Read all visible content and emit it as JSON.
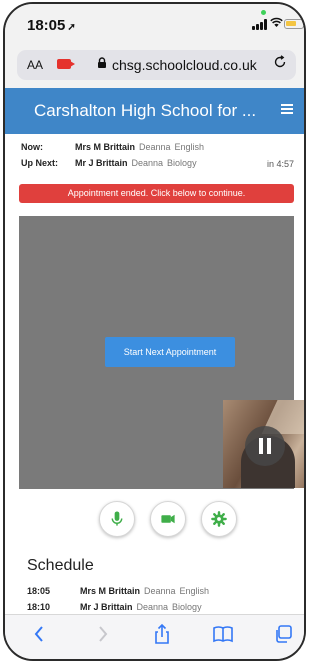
{
  "status": {
    "time": "18:05",
    "location_arrow": "➚"
  },
  "browser": {
    "text_size_label": "AA",
    "url": "chsg.schoolcloud.co.uk"
  },
  "header": {
    "title": "Carshalton High School for ..."
  },
  "appointment": {
    "now_label": "Now:",
    "now_teacher": "Mrs M Brittain",
    "now_student": "Deanna",
    "now_subject": "English",
    "next_label": "Up Next:",
    "next_teacher": "Mr J Brittain",
    "next_student": "Deanna",
    "next_subject": "Biology",
    "next_in": "in 4:57"
  },
  "alert": {
    "text": "Appointment ended. Click below to continue."
  },
  "video": {
    "start_button_label": "Start Next Appointment"
  },
  "controls": {
    "accent": "#3fae49"
  },
  "schedule": {
    "title": "Schedule",
    "rows": [
      {
        "time": "18:05",
        "teacher": "Mrs M Brittain",
        "student": "Deanna",
        "subject": "English"
      },
      {
        "time": "18:10",
        "teacher": "Mr J Brittain",
        "student": "Deanna",
        "subject": "Biology"
      }
    ]
  },
  "colors": {
    "header": "#3f86c8",
    "alert": "#e0403d",
    "button": "#3c8fe0"
  }
}
